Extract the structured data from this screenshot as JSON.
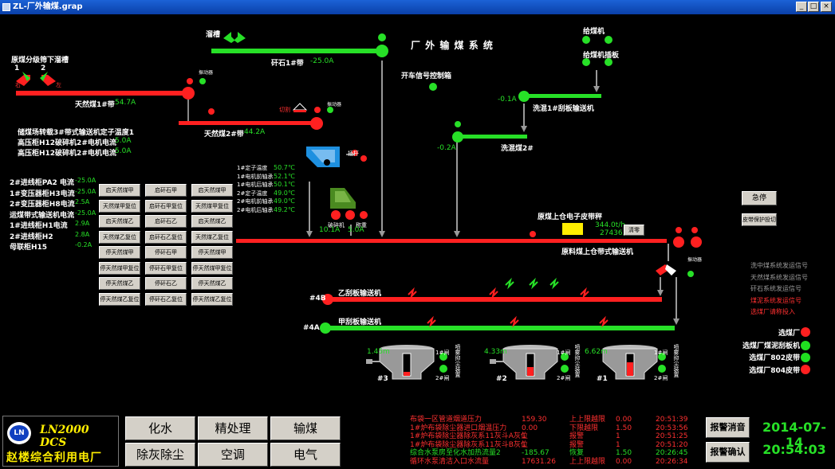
{
  "window": {
    "title": "ZL-厂外输煤.grap"
  },
  "system_title": "厂 外 输 煤 系 统",
  "labels": {
    "chute_top": "溜槽",
    "classifier_chute": "原煤分级筛下溜槽",
    "chute_no1": "1",
    "chute_no2": "2",
    "chute_left": "右",
    "chute_right": "左",
    "vibrator": "振动器",
    "belt_gangue1": "矸石1#带",
    "belt_natural1": "天然煤1#带",
    "belt_natural2": "天然煤2#带",
    "start_signal": "开车信号控制箱",
    "feeder": "给煤机",
    "feeder_plate": "给煤机插板",
    "wash_scraper1": "洗混1#刮板输送机",
    "wash_coal2": "洗混煤2#",
    "cutter": "切割",
    "bypass": "插杆",
    "crusher": "破碎机",
    "weigh": "称重",
    "scale_label": "原煤上仓电子皮带秤",
    "bin_belt": "原料煤上仓带式输送机",
    "scraper_b": "乙刮板输送机",
    "scraper_a": "甲刮板输送机",
    "tag_4b": "#4B",
    "tag_4a": "#4A",
    "bin3": "#3",
    "bin2": "#2",
    "bin1": "#1",
    "gate1": "1#闸",
    "gate2": "2#闸",
    "dust": "喷雾抑尘装置",
    "marker_red": "⑩",
    "marker_red2": "⑪",
    "marker_red3": "⑫",
    "marker_red4": "⑨"
  },
  "readings": {
    "gangue1_current": "-25.0A",
    "natural1_current": "54.7A",
    "natural2_current": "44.2A",
    "wash1_current": "-0.1A",
    "wash2_current": "-0.2A",
    "bin_belt_current": "10.1A",
    "crusher_current": "5.0A",
    "flow": "344.0t/h",
    "total": "27436.4t",
    "bin3_level": "1.45m",
    "bin2_level": "4.33m",
    "bin1_level": "6.62m"
  },
  "left_info": [
    {
      "label": "储煤场转载3#带式输送机定子温度1",
      "value": ""
    },
    {
      "label": "高压柜H12破碎机2#电机电流",
      "value": "5.0A"
    },
    {
      "label": "高压柜H12破碎机2#电机电流",
      "value": "5.0A"
    }
  ],
  "left_info2": [
    {
      "label": "2#进线柜PA2 电流",
      "value": "-25.0A"
    },
    {
      "label": "1#变压器柜H3电流",
      "value": "-25.0A"
    },
    {
      "label": "2#变压器柜H8电流",
      "value": "2.5A"
    },
    {
      "label": "运煤带式输送机电流",
      "value": "-25.0A"
    },
    {
      "label": "1#进线柜H1电流",
      "value": "2.9A"
    },
    {
      "label": "2#进线柜H2",
      "value": "2.8A"
    },
    {
      "label": "母联柜H15",
      "value": "-0.2A"
    }
  ],
  "temps": [
    {
      "label": "1#定子温度",
      "value": "50.7℃"
    },
    {
      "label": "1#电机前轴承",
      "value": "52.1℃"
    },
    {
      "label": "1#电机后轴承",
      "value": "50.1℃"
    },
    {
      "label": "2#定子温度",
      "value": "49.0℃"
    },
    {
      "label": "2#电机前轴承",
      "value": "49.0℃"
    },
    {
      "label": "2#电机后轴承",
      "value": "49.2℃"
    }
  ],
  "control_buttons": [
    [
      "启天然煤甲",
      "启矸石甲",
      "启天然煤甲"
    ],
    [
      "天然煤甲复位",
      "启矸石甲复位",
      "天然煤甲复位"
    ],
    [
      "启天然煤乙",
      "启矸石乙",
      "启天然煤乙"
    ],
    [
      "天然煤乙复位",
      "启矸石乙复位",
      "天然煤乙复位"
    ],
    [
      "停天然煤甲",
      "停矸石甲",
      "停天然煤甲"
    ],
    [
      "停天然煤甲复位",
      "停矸石甲复位",
      "停天然煤甲复位"
    ],
    [
      "停天然煤乙",
      "停矸石乙",
      "停天然煤乙"
    ],
    [
      "停天然煤乙复位",
      "停矸石乙复位",
      "停天然煤乙复位"
    ]
  ],
  "right_buttons": {
    "estop": "急停",
    "protect": "皮带保护投切",
    "clear": "清零"
  },
  "signal_list": [
    {
      "text": "洗中煤系统发运信号",
      "color": "#9a9a9a"
    },
    {
      "text": "天然煤系统发运信号",
      "color": "#9a9a9a"
    },
    {
      "text": "矸石系统发运信号",
      "color": "#9a9a9a"
    },
    {
      "text": "煤泥系统发运信号",
      "color": "#ff3030"
    },
    {
      "text": "选煤厂请称投入",
      "color": "#ff3030"
    }
  ],
  "status_legend": [
    {
      "text": "选煤厂",
      "color": "#ff2020"
    },
    {
      "text": "选煤厂煤泥刮板机",
      "color": "#20e020"
    },
    {
      "text": "选煤厂802皮带",
      "color": "#20e020"
    },
    {
      "text": "选煤厂804皮带",
      "color": "#ff2020"
    }
  ],
  "bottom": {
    "brand": "LN2000 DCS",
    "plant": "赵楼综合利用电厂",
    "logo_letters": "LN",
    "nav": [
      "化水",
      "精处理",
      "输煤",
      "除灰除尘",
      "空调",
      "电气"
    ],
    "alarms": [
      {
        "name": "布袋一区管道烟道压力",
        "value": "159.30",
        "type": "上上限越限",
        "limit": "0.00",
        "time": "20:51:39",
        "color": "#ff3030"
      },
      {
        "name": "1#炉布袋除尘器进口烟温压力",
        "value": "0.00",
        "type": "下限越限",
        "limit": "1.50",
        "time": "20:53:56",
        "color": "#ff3030"
      },
      {
        "name": "1#炉布袋除尘器除灰系11灰斗A灰位",
        "value": "1",
        "type": "报警",
        "limit": "1",
        "time": "20:51:25",
        "color": "#ff3030"
      },
      {
        "name": "1#炉布袋除尘器除灰系11灰斗B灰位",
        "value": "1",
        "type": "报警",
        "limit": "1",
        "time": "20:51:20",
        "color": "#ff3030"
      },
      {
        "name": "综合水泵房至化水加热流量2",
        "value": "-185.67",
        "type": "恢复",
        "limit": "1.50",
        "time": "20:26:45",
        "color": "#27e027"
      },
      {
        "name": "循环水泵清洁入口水流量",
        "value": "17631.26",
        "type": "上上限越限",
        "limit": "0.00",
        "time": "20:26:34",
        "color": "#ff3030"
      }
    ],
    "alarm_buttons": [
      "报警消音",
      "报警确认"
    ],
    "date": "2014-07-14",
    "time": "20:54:03"
  }
}
